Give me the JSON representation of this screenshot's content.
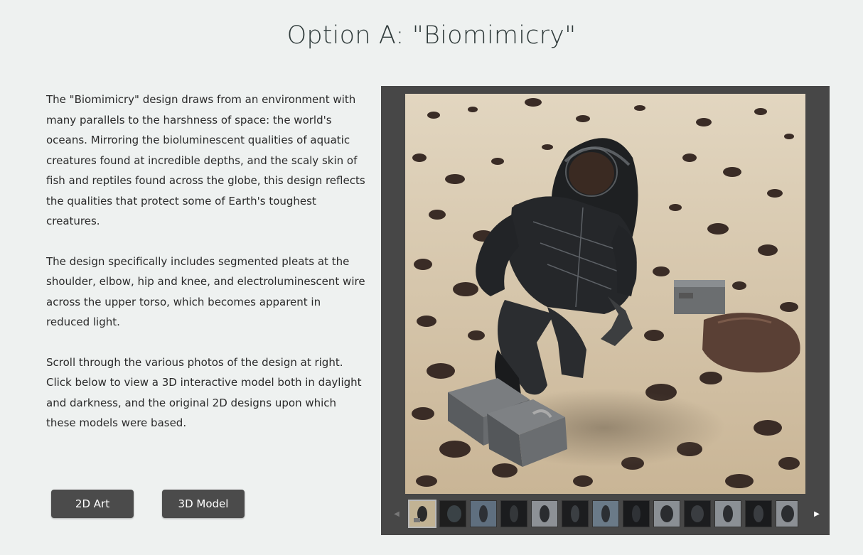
{
  "page": {
    "title": "Option A: \"Biomimicry\""
  },
  "description": {
    "paragraphs": [
      "The \"Biomimicry\" design draws from an environment with many parallels to the harshness of space: the world's oceans. Mirroring the bioluminescent qualities of aquatic creatures found at incredible depths, and the scaly skin of fish and reptiles found across the globe, this design reflects the qualities that protect some of Earth's toughest creatures.",
      "The design specifically includes segmented pleats at the shoulder, elbow, hip and knee, and electroluminescent wire across the upper torso, which becomes apparent in reduced light.",
      "Scroll through the various photos of the design at right. Click below to view a 3D interactive model both in daylight and darkness, and the original 2D designs upon which these models were based."
    ]
  },
  "buttons": {
    "art_2d": "2D Art",
    "model_3d": "3D Model"
  },
  "gallery": {
    "prev_icon": "chevron-left-icon",
    "next_icon": "chevron-right-icon",
    "active_thumb": 0,
    "thumbs": [
      "desert",
      "dark",
      "blue",
      "dark",
      "grey",
      "dark",
      "blue",
      "dark",
      "grey",
      "dark",
      "grey",
      "dark",
      "grey"
    ]
  },
  "colors": {
    "gallery_bg": "#474747",
    "button_bg": "#4b4b4b",
    "page_bg": "#eef1f0"
  }
}
